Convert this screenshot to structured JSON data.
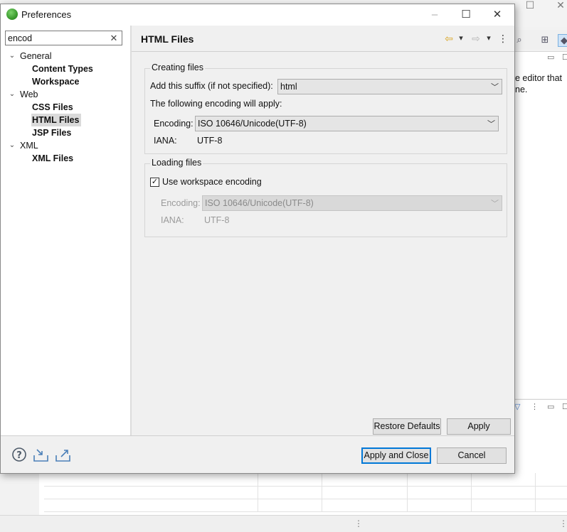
{
  "dialog": {
    "title": "Preferences",
    "icon": "eclipse-spring-icon",
    "controls": {
      "minimize": "–",
      "maximize": "☐",
      "close": "✕"
    }
  },
  "filter": {
    "value": "encod",
    "clear_glyph": "✕"
  },
  "tree": {
    "groups": [
      {
        "label": "General",
        "children": [
          {
            "label": "Content Types"
          },
          {
            "label": "Workspace"
          }
        ]
      },
      {
        "label": "Web",
        "children": [
          {
            "label": "CSS Files"
          },
          {
            "label": "HTML Files",
            "selected": true
          },
          {
            "label": "JSP Files"
          }
        ]
      },
      {
        "label": "XML",
        "children": [
          {
            "label": "XML Files"
          }
        ]
      }
    ]
  },
  "page": {
    "title": "HTML Files",
    "nav": {
      "back": "⇦",
      "forward": "⇨",
      "dropdown": "▾",
      "menu": "⋮"
    },
    "creating": {
      "title": "Creating files",
      "suffix_label": "Add this suffix (if not specified):",
      "suffix_value": "html",
      "apply_text": "The following encoding will apply:",
      "encoding_label": "Encoding:",
      "encoding_value": "ISO 10646/Unicode(UTF-8)",
      "iana_label": "IANA:",
      "iana_value": "UTF-8"
    },
    "loading": {
      "title": "Loading files",
      "use_workspace_label": "Use workspace encoding",
      "use_workspace_checked": true,
      "encoding_label": "Encoding:",
      "encoding_value": "ISO 10646/Unicode(UTF-8)",
      "iana_label": "IANA:",
      "iana_value": "UTF-8"
    },
    "restore_defaults": "Restore Defaults",
    "apply": "Apply"
  },
  "footer": {
    "help_icon": "help-icon",
    "import_icon": "import-icon",
    "export_icon": "export-icon",
    "apply_close": "Apply and Close",
    "cancel": "Cancel"
  },
  "background": {
    "view_text_1": "e editor that",
    "view_text_2": "ne."
  },
  "colors": {
    "accent": "#0078d7",
    "selection": "#dadada",
    "dialog_bg": "#f0f0f0"
  }
}
